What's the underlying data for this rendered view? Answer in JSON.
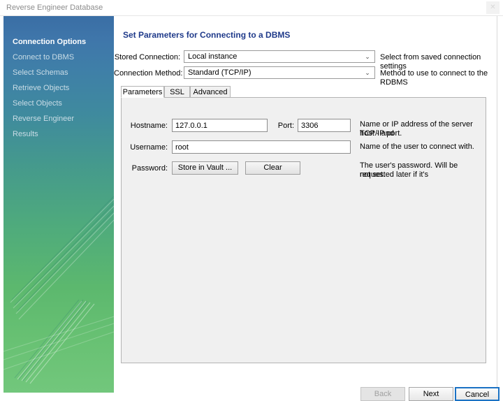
{
  "window": {
    "title": "Reverse Engineer Database",
    "close_icon": "close-icon",
    "close_glyph": "✕"
  },
  "sidebar": {
    "steps": [
      {
        "label": "Connection Options",
        "active": true
      },
      {
        "label": "Connect to DBMS",
        "active": false
      },
      {
        "label": "Select Schemas",
        "active": false
      },
      {
        "label": "Retrieve Objects",
        "active": false
      },
      {
        "label": "Select Objects",
        "active": false
      },
      {
        "label": "Reverse Engineer",
        "active": false
      },
      {
        "label": "Results",
        "active": false
      }
    ],
    "gradient_top": "#3a6ea5",
    "gradient_bottom": "#72c77c"
  },
  "main": {
    "title": "Set Parameters for Connecting to a DBMS",
    "title_color": "#1f3a8a",
    "stored_connection": {
      "label": "Stored Connection:",
      "value": "Local instance",
      "hint": "Select from saved connection settings",
      "arrow_glyph": "⌄"
    },
    "connection_method": {
      "label": "Connection Method:",
      "value": "Standard (TCP/IP)",
      "hint": "Method to use to connect to the RDBMS",
      "arrow_glyph": "⌄"
    },
    "tabs": [
      {
        "label": "Parameters",
        "active": true
      },
      {
        "label": "SSL",
        "active": false
      },
      {
        "label": "Advanced",
        "active": false
      }
    ],
    "parameters": {
      "hostname": {
        "label": "Hostname:",
        "value": "127.0.0.1",
        "hint_line1": "Name or IP address of the server host - and",
        "hint_line2": "TCP/IP port."
      },
      "port": {
        "label": "Port:",
        "value": "3306"
      },
      "username": {
        "label": "Username:",
        "value": "root",
        "hint": "Name of the user to connect with."
      },
      "password": {
        "label": "Password:",
        "store_button": "Store in Vault ...",
        "clear_button": "Clear",
        "hint_line1": "The user's password. Will be requested later if it's",
        "hint_line2": "not set."
      }
    }
  },
  "footer": {
    "back": "Back",
    "next": "Next",
    "cancel": "Cancel",
    "focus_color": "#1b72c4"
  }
}
